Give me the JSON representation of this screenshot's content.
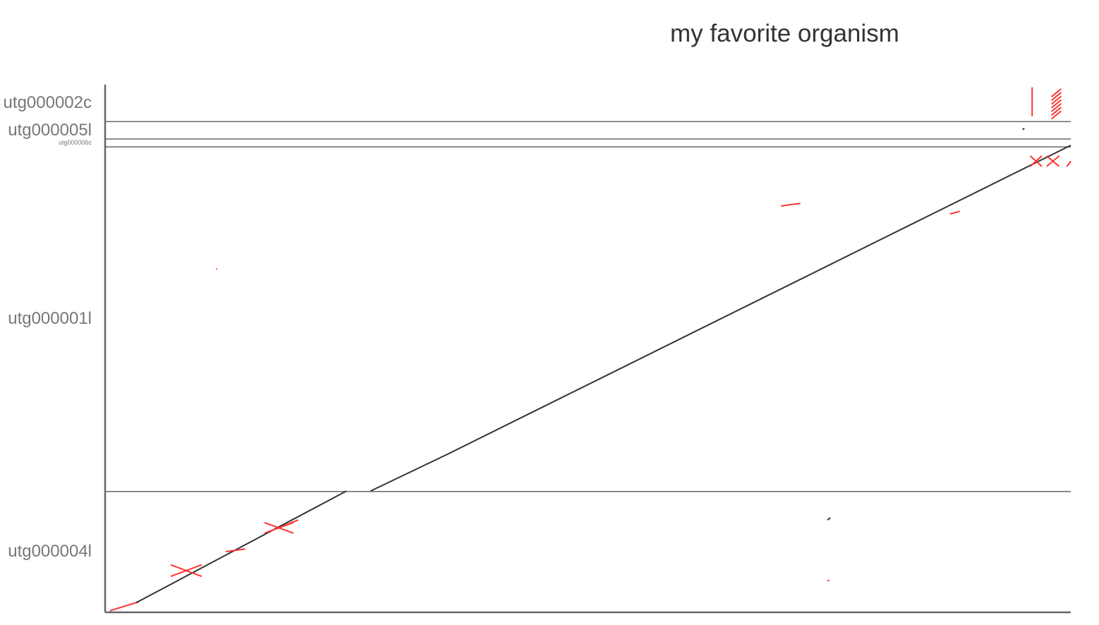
{
  "chart_data": {
    "type": "scatter",
    "title": "my favorite organism",
    "xlabel": "",
    "ylabel": "",
    "grid": false,
    "y_contigs": [
      {
        "name": "utg000002c",
        "size_pct": 7.0
      },
      {
        "name": "utg000005l",
        "size_pct": 3.3
      },
      {
        "name": "utg000006c",
        "size_pct": 1.5
      },
      {
        "name": "utg000001l",
        "size_pct": 65.3
      },
      {
        "name": "utg000004l",
        "size_pct": 22.9
      }
    ],
    "xlim": [
      0,
      100
    ],
    "ylim": [
      0,
      100
    ],
    "colors": {
      "forward": "#333333",
      "reverse": "#ff3333",
      "axis": "#666666"
    },
    "segments": [
      {
        "x": [
          0.5,
          3.5
        ],
        "y": [
          0.3,
          2.0
        ],
        "strand": "reverse"
      },
      {
        "x": [
          3.2,
          25.0
        ],
        "y": [
          1.8,
          23.0
        ],
        "strand": "forward"
      },
      {
        "x": [
          6.8,
          10.0
        ],
        "y": [
          6.8,
          9.0
        ],
        "strand": "reverse"
      },
      {
        "x": [
          6.8,
          10.0
        ],
        "y": [
          9.0,
          6.8
        ],
        "strand": "reverse"
      },
      {
        "x": [
          16.5,
          19.5
        ],
        "y": [
          15.0,
          17.0
        ],
        "strand": "reverse"
      },
      {
        "x": [
          16.5,
          19.5
        ],
        "y": [
          17.0,
          15.0
        ],
        "strand": "reverse"
      },
      {
        "x": [
          18.0,
          20.0
        ],
        "y": [
          16.0,
          17.5
        ],
        "strand": "reverse"
      },
      {
        "x": [
          12.5,
          14.5
        ],
        "y": [
          11.5,
          12.0
        ],
        "strand": "reverse"
      },
      {
        "x": [
          27.5,
          35.5
        ],
        "y": [
          23.0,
          30.0
        ],
        "strand": "forward"
      },
      {
        "x": [
          35.5,
          100
        ],
        "y": [
          30.0,
          88.5
        ],
        "strand": "forward"
      },
      {
        "x": [
          70.0,
          72.0
        ],
        "y": [
          77.0,
          77.5
        ],
        "strand": "reverse"
      },
      {
        "x": [
          87.5,
          88.5
        ],
        "y": [
          75.5,
          76.0
        ],
        "strand": "reverse"
      },
      {
        "x": [
          96.0,
          96.0
        ],
        "y": [
          94.0,
          99.5
        ],
        "strand": "reverse"
      },
      {
        "x": [
          98.0,
          99.0
        ],
        "y": [
          93.5,
          95.0
        ],
        "strand": "reverse"
      },
      {
        "x": [
          98.0,
          99.0
        ],
        "y": [
          94.2,
          95.7
        ],
        "strand": "reverse"
      },
      {
        "x": [
          98.0,
          99.0
        ],
        "y": [
          94.9,
          96.4
        ],
        "strand": "reverse"
      },
      {
        "x": [
          98.0,
          99.0
        ],
        "y": [
          95.6,
          97.1
        ],
        "strand": "reverse"
      },
      {
        "x": [
          98.0,
          99.0
        ],
        "y": [
          96.3,
          97.8
        ],
        "strand": "reverse"
      },
      {
        "x": [
          98.0,
          99.0
        ],
        "y": [
          97.0,
          98.5
        ],
        "strand": "reverse"
      },
      {
        "x": [
          98.0,
          99.0
        ],
        "y": [
          97.7,
          99.2
        ],
        "strand": "reverse"
      },
      {
        "x": [
          95.8,
          97.0
        ],
        "y": [
          84.5,
          86.5
        ],
        "strand": "reverse"
      },
      {
        "x": [
          95.8,
          97.0
        ],
        "y": [
          86.5,
          84.5
        ],
        "strand": "reverse"
      },
      {
        "x": [
          97.5,
          98.8
        ],
        "y": [
          84.5,
          86.5
        ],
        "strand": "reverse"
      },
      {
        "x": [
          97.5,
          98.8
        ],
        "y": [
          86.5,
          84.5
        ],
        "strand": "reverse"
      },
      {
        "x": [
          99.6,
          100
        ],
        "y": [
          84.5,
          85.5
        ],
        "strand": "reverse"
      },
      {
        "x": [
          11.5,
          11.6
        ],
        "y": [
          65.0,
          65.1
        ],
        "strand": "reverse"
      },
      {
        "x": [
          74.8,
          75.0
        ],
        "y": [
          6.0,
          6.05
        ],
        "strand": "reverse"
      },
      {
        "x": [
          74.8,
          75.1
        ],
        "y": [
          17.5,
          17.9
        ],
        "strand": "forward"
      },
      {
        "x": [
          95.0,
          95.2
        ],
        "y": [
          91.5,
          91.7
        ],
        "strand": "forward"
      }
    ]
  }
}
